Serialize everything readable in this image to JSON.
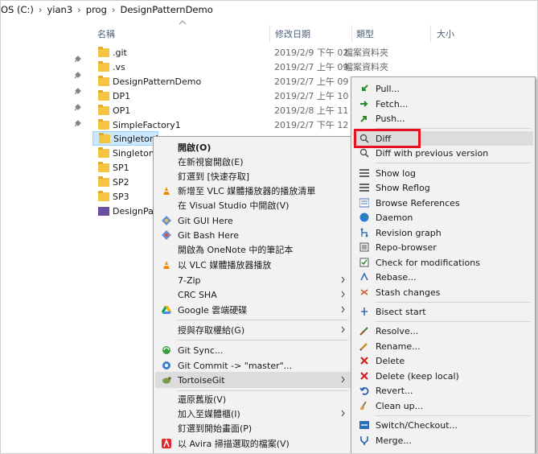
{
  "breadcrumb": [
    "OS (C:)",
    "yian3",
    "prog",
    "DesignPatternDemo"
  ],
  "columns": {
    "name": "名稱",
    "date": "修改日期",
    "type": "類型",
    "size": "大小"
  },
  "files": [
    {
      "name": ".git",
      "date": "2019/2/9 下午 02...",
      "type": "檔案資料夾",
      "icon": "folder-icon"
    },
    {
      "name": ".vs",
      "date": "2019/2/7 上午 09...",
      "type": "檔案資料夾",
      "icon": "folder-icon"
    },
    {
      "name": "DesignPatternDemo",
      "date": "2019/2/7 上午 09...",
      "type": "",
      "icon": "folder-icon"
    },
    {
      "name": "DP1",
      "date": "2019/2/7 上午 10...",
      "type": "",
      "icon": "folder-icon"
    },
    {
      "name": "OP1",
      "date": "2019/2/8 上午 11...",
      "type": "",
      "icon": "folder-icon"
    },
    {
      "name": "SimpleFactory1",
      "date": "2019/2/7 下午 12...",
      "type": "",
      "icon": "folder-icon"
    },
    {
      "name": "Singleton1",
      "date": "",
      "type": "",
      "icon": "folder-icon"
    },
    {
      "name": "Singleton2",
      "date": "",
      "type": "",
      "icon": "folder-icon"
    },
    {
      "name": "SP1",
      "date": "",
      "type": "",
      "icon": "folder-icon"
    },
    {
      "name": "SP2",
      "date": "",
      "type": "",
      "icon": "folder-icon"
    },
    {
      "name": "SP3",
      "date": "",
      "type": "",
      "icon": "folder-icon"
    },
    {
      "name": "DesignPatt",
      "date": "",
      "type": "",
      "icon": "visual-studio-solution-icon"
    }
  ],
  "context_menu": [
    {
      "label": "開啟(O)",
      "bold": true
    },
    {
      "label": "在新視窗開啟(E)"
    },
    {
      "label": "釘選到 [快速存取]"
    },
    {
      "label": "新增至 VLC 媒體播放器的播放清單",
      "icon": "vlc-icon"
    },
    {
      "label": "在 Visual Studio 中開啟(V)"
    },
    {
      "label": "Git GUI Here",
      "icon": "git-gui-icon"
    },
    {
      "label": "Git Bash Here",
      "icon": "git-bash-icon"
    },
    {
      "label": "開啟為 OneNote 中的筆記本"
    },
    {
      "label": "以 VLC 媒體播放器播放",
      "icon": "vlc-icon"
    },
    {
      "label": "7-Zip",
      "submenu": true
    },
    {
      "label": "CRC SHA",
      "submenu": true
    },
    {
      "label": "Google 雲端硬碟",
      "icon": "google-drive-icon",
      "submenu": true
    },
    {
      "label": "授與存取權給(G)",
      "submenu": true
    },
    {
      "label": "Git Sync...",
      "icon": "git-sync-icon"
    },
    {
      "label": "Git Commit -> \"master\"...",
      "icon": "git-commit-icon"
    },
    {
      "label": "TortoiseGit",
      "icon": "tortoisegit-icon",
      "submenu": true,
      "highlighted": true
    },
    {
      "label": "還原舊版(V)"
    },
    {
      "label": "加入至媒體櫃(I)",
      "submenu": true
    },
    {
      "label": "釘選到開始畫面(P)"
    },
    {
      "label": "以 Avira 掃描選取的檔案(V)",
      "icon": "avira-icon"
    }
  ],
  "tortoise_menu": [
    {
      "label": "Pull...",
      "icon": "pull-icon"
    },
    {
      "label": "Fetch...",
      "icon": "fetch-icon"
    },
    {
      "label": "Push...",
      "icon": "push-icon"
    },
    {
      "label": "Diff",
      "icon": "diff-icon",
      "highlighted": true,
      "boxed": true
    },
    {
      "label": "Diff with previous version",
      "icon": "diff-previous-icon"
    },
    {
      "label": "Show log",
      "icon": "show-log-icon"
    },
    {
      "label": "Show Reflog",
      "icon": "show-reflog-icon"
    },
    {
      "label": "Browse References",
      "icon": "browse-references-icon"
    },
    {
      "label": "Daemon",
      "icon": "daemon-icon"
    },
    {
      "label": "Revision graph",
      "icon": "revision-graph-icon"
    },
    {
      "label": "Repo-browser",
      "icon": "repo-browser-icon"
    },
    {
      "label": "Check for modifications",
      "icon": "check-modifications-icon"
    },
    {
      "label": "Rebase...",
      "icon": "rebase-icon"
    },
    {
      "label": "Stash changes",
      "icon": "stash-icon"
    },
    {
      "label": "Bisect start",
      "icon": "bisect-icon"
    },
    {
      "label": "Resolve...",
      "icon": "resolve-icon"
    },
    {
      "label": "Rename...",
      "icon": "rename-icon"
    },
    {
      "label": "Delete",
      "icon": "delete-icon"
    },
    {
      "label": "Delete (keep local)",
      "icon": "delete-keep-local-icon"
    },
    {
      "label": "Revert...",
      "icon": "revert-icon"
    },
    {
      "label": "Clean up...",
      "icon": "cleanup-icon"
    },
    {
      "label": "Switch/Checkout...",
      "icon": "switch-checkout-icon"
    },
    {
      "label": "Merge...",
      "icon": "merge-icon"
    }
  ],
  "colors": {
    "selection": "#cce8ff",
    "highlight_box": "#e81123",
    "menu_bg": "#f2f2f2"
  }
}
